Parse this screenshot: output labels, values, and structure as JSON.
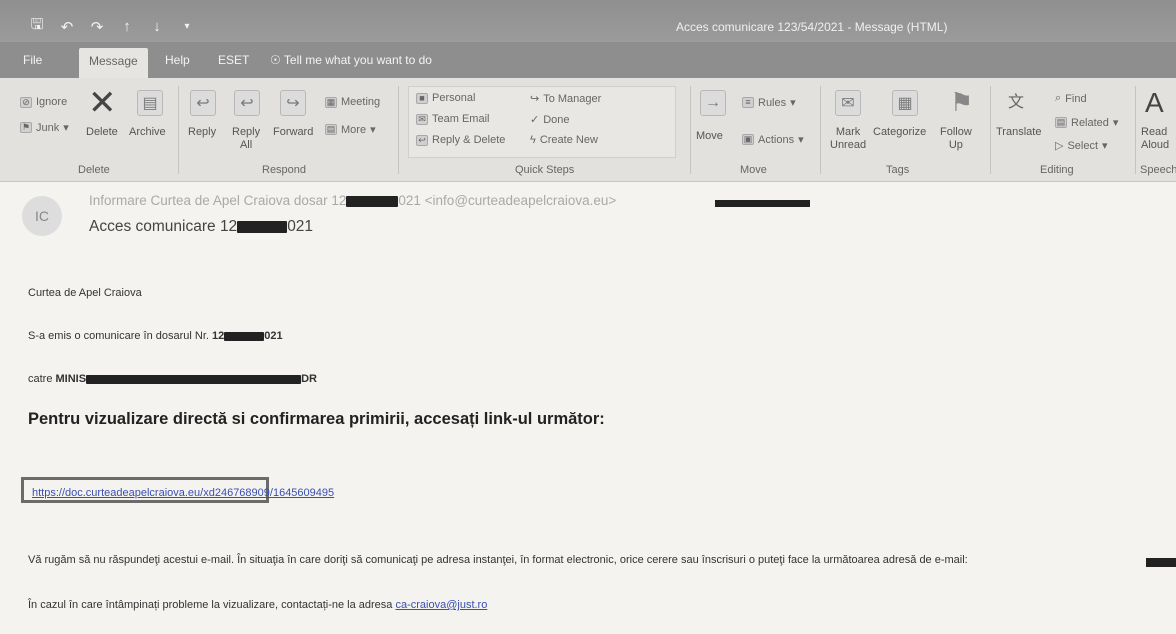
{
  "window": {
    "title": "Acces comunicare 123/54/2021  -  Message (HTML)",
    "qat_icons": [
      "save-icon",
      "undo-icon",
      "redo-icon",
      "up-arrow-icon",
      "down-arrow-icon",
      "customize-icon"
    ]
  },
  "tabs": [
    "File",
    "Message",
    "Help",
    "ESET",
    "Tell me what you want to do"
  ],
  "active_tab": "Message",
  "ribbon": {
    "delete_group": {
      "label": "Delete",
      "ignore": "Ignore",
      "junk": "Junk",
      "delete": "Delete",
      "archive": "Archive"
    },
    "respond_group": {
      "label": "Respond",
      "reply": "Reply",
      "reply_all_1": "Reply",
      "reply_all_2": "All",
      "forward": "Forward",
      "meeting": "Meeting",
      "more": "More"
    },
    "quick_steps_group": {
      "label": "Quick Steps",
      "items": [
        "Personal",
        "Team Email",
        "Reply & Delete",
        "To Manager",
        "Done",
        "Create New"
      ]
    },
    "move_group": {
      "label": "Move",
      "move": "Move",
      "rules": "Rules",
      "actions": "Actions"
    },
    "tags_group": {
      "label": "Tags",
      "mark_unread_1": "Mark",
      "mark_unread_2": "Unread",
      "categorize": "Categorize",
      "follow_up_1": "Follow",
      "follow_up_2": "Up"
    },
    "editing_group": {
      "label": "Editing",
      "translate": "Translate",
      "find": "Find",
      "related": "Related",
      "select": "Select"
    },
    "speech_group": {
      "label": "Speech",
      "read_aloud_1": "Read",
      "read_aloud_2": "Aloud"
    }
  },
  "message": {
    "avatar_initials": "IC",
    "from_prefix": "Informare Curtea de Apel Craiova dosar 12",
    "from_suffix": "021 <info@curteadeapelcraiova.eu>",
    "subject_prefix": "Acces comunicare 12",
    "subject_suffix": "021"
  },
  "body": {
    "court": "Curtea de Apel Craiova",
    "issued_prefix": "S-a emis o comunicare în dosarul Nr. ",
    "issued_num_prefix": "12",
    "issued_num_suffix": "021",
    "to_prefix": "catre ",
    "to_bold_prefix": "MINIS",
    "to_bold_suffix": "DR",
    "headline": "Pentru vizualizare directă si confirmarea primirii, accesați link-ul următor:",
    "link": "https://doc.curteadeapelcraiova.eu/xd246768909/1645609495",
    "notice": "Vă rugăm să nu răspundeţi acestui  e-mail. În situaţia în care doriţi să comunicaţi pe adresa instanţei,  în format electronic, orice cerere sau înscrisuri o puteţi face la următoarea adresă de e-mail:",
    "problems_prefix": "În cazul în care întâmpinați probleme la vizualizare, contactați-ne la adresa ",
    "problems_email": "ca-craiova@just.ro"
  }
}
